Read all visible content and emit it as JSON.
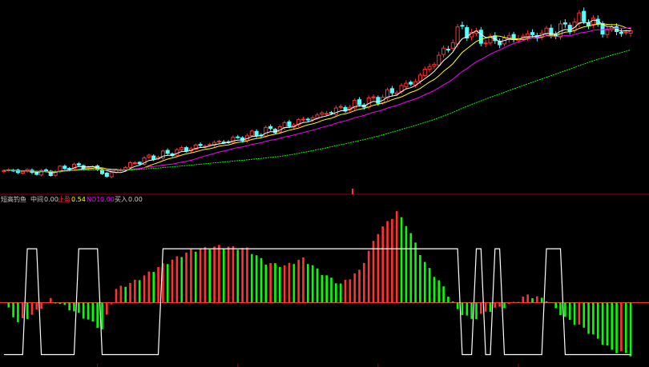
{
  "indicator_header": {
    "name": "短高钓鱼",
    "label_a": "中间",
    "value_a": "0.00",
    "label_b": "止盈",
    "value_b": "0.54",
    "label_c": "NO1",
    "value_c": "0.00",
    "label_d": "买入",
    "value_d": "0.00"
  },
  "colors": {
    "background": "#000000",
    "up_candle": "#ff3232",
    "down_candle": "#54ffff",
    "ma_short": "#ffffff",
    "ma_mid": "#ffff00",
    "ma_long": "#ff00ff",
    "ma_slow": "#00ff00",
    "divider": "#9b0000",
    "bar_up": "#ff3232",
    "bar_down": "#00ff00",
    "signal_line": "#ffffff"
  },
  "chart_data": [
    {
      "type": "candlestick",
      "title": "",
      "n_bars": 135,
      "close_anchors": [
        [
          0,
          9.6
        ],
        [
          10,
          9.4
        ],
        [
          14,
          10.0
        ],
        [
          18,
          9.9
        ],
        [
          20,
          9.7
        ],
        [
          22,
          9.1
        ],
        [
          24,
          9.6
        ],
        [
          30,
          10.6
        ],
        [
          40,
          11.6
        ],
        [
          50,
          12.4
        ],
        [
          60,
          13.5
        ],
        [
          70,
          14.8
        ],
        [
          80,
          15.9
        ],
        [
          88,
          17.5
        ],
        [
          94,
          20.0
        ],
        [
          98,
          22.2
        ],
        [
          100,
          21.5
        ],
        [
          104,
          20.9
        ],
        [
          110,
          21.3
        ],
        [
          118,
          21.8
        ],
        [
          124,
          23.0
        ],
        [
          128,
          22.0
        ],
        [
          134,
          21.7
        ]
      ],
      "series": [
        {
          "name": "MA5",
          "color_key": "ma_short",
          "period": 5
        },
        {
          "name": "MA10",
          "color_key": "ma_mid",
          "period": 10
        },
        {
          "name": "MA20",
          "color_key": "ma_long",
          "period": 20
        },
        {
          "name": "MA60",
          "color_key": "ma_slow",
          "period": 60
        }
      ],
      "ylim": [
        8.0,
        24.0
      ]
    },
    {
      "type": "bar",
      "title": "",
      "n_bars": 135,
      "value_anchors": [
        [
          0,
          0.0
        ],
        [
          3,
          -0.32
        ],
        [
          6,
          -0.2
        ],
        [
          10,
          0.05
        ],
        [
          14,
          -0.1
        ],
        [
          18,
          -0.28
        ],
        [
          21,
          -0.44
        ],
        [
          24,
          0.22
        ],
        [
          28,
          0.35
        ],
        [
          34,
          0.62
        ],
        [
          40,
          0.85
        ],
        [
          46,
          0.92
        ],
        [
          52,
          0.88
        ],
        [
          56,
          0.65
        ],
        [
          60,
          0.6
        ],
        [
          64,
          0.72
        ],
        [
          68,
          0.48
        ],
        [
          72,
          0.3
        ],
        [
          76,
          0.52
        ],
        [
          80,
          1.15
        ],
        [
          84,
          1.48
        ],
        [
          86,
          1.28
        ],
        [
          90,
          0.65
        ],
        [
          94,
          0.25
        ],
        [
          97,
          -0.12
        ],
        [
          100,
          -0.28
        ],
        [
          104,
          -0.12
        ],
        [
          108,
          -0.04
        ],
        [
          112,
          0.12
        ],
        [
          116,
          0.05
        ],
        [
          120,
          -0.25
        ],
        [
          124,
          -0.42
        ],
        [
          130,
          -0.78
        ],
        [
          134,
          -0.85
        ]
      ],
      "signal_line_steps": [
        [
          0,
          0
        ],
        [
          5,
          1
        ],
        [
          8,
          0
        ],
        [
          16,
          1
        ],
        [
          21,
          0
        ],
        [
          34,
          1
        ],
        [
          98,
          0
        ],
        [
          101,
          1
        ],
        [
          103,
          0
        ],
        [
          105,
          1
        ],
        [
          107,
          0
        ],
        [
          116,
          1
        ],
        [
          120,
          0
        ]
      ],
      "ylim": [
        -1.0,
        1.6
      ]
    }
  ]
}
